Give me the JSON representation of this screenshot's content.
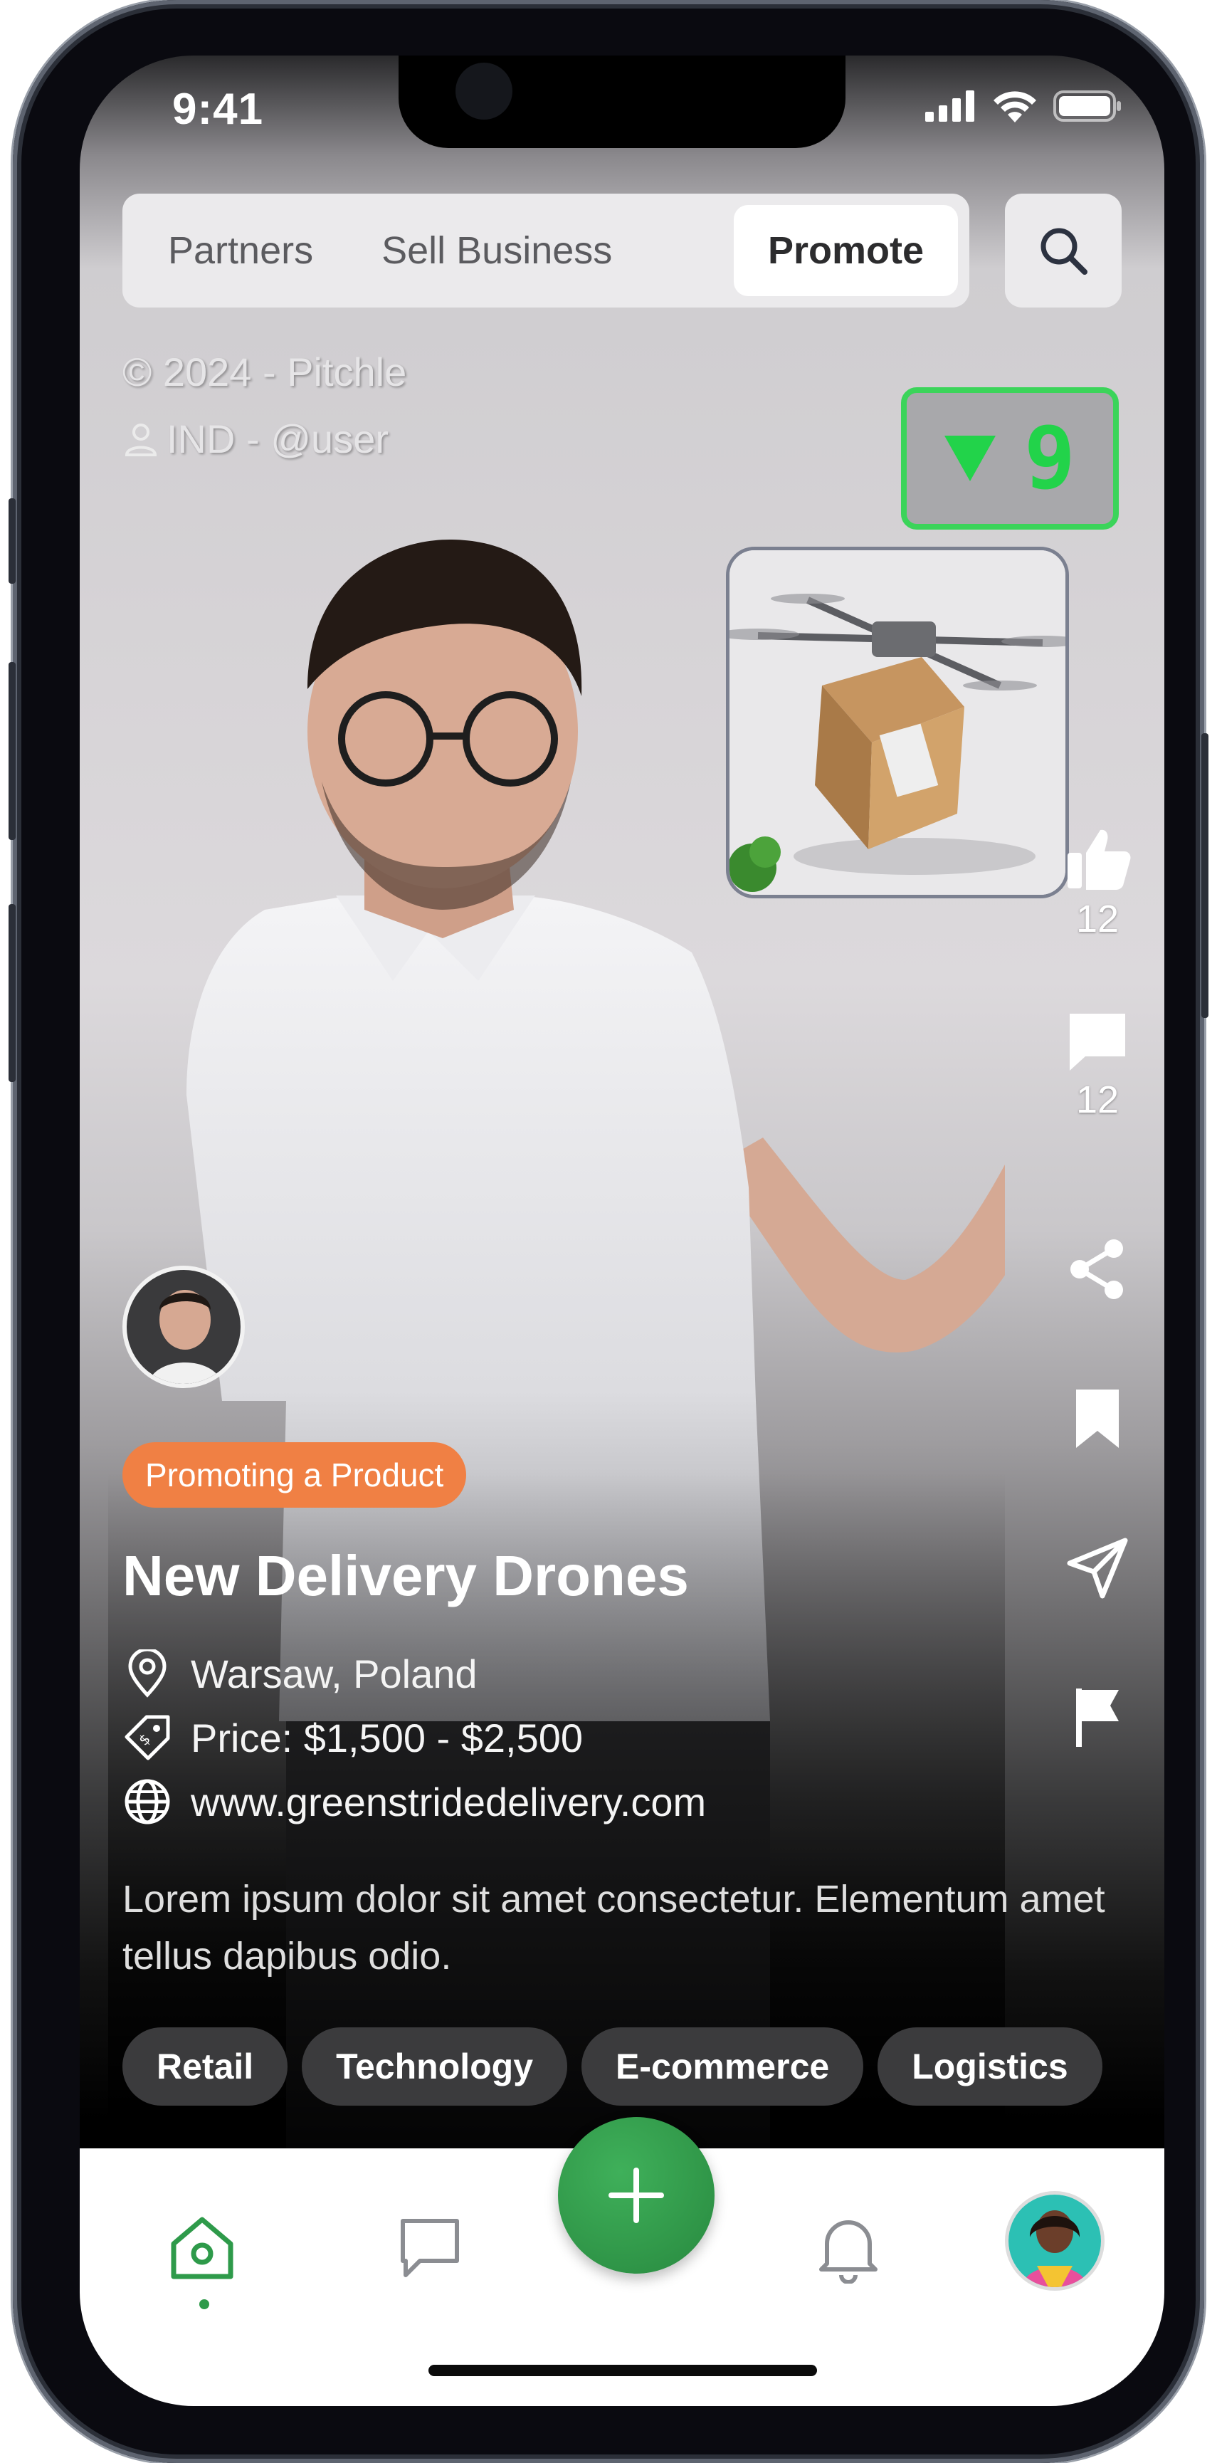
{
  "status_bar": {
    "time": "9:41"
  },
  "tabs": [
    {
      "label": "Partners",
      "active": false
    },
    {
      "label": "Sell Business",
      "active": false
    },
    {
      "label": "Promote",
      "active": true
    }
  ],
  "watermark": {
    "copyright": "© 2024 - Pitchle",
    "user": "IND - @user"
  },
  "counter": {
    "value": "9",
    "direction": "down",
    "color": "#22d34a"
  },
  "actions": {
    "likes": "12",
    "comments": "12"
  },
  "post": {
    "badge": "Promoting a Product",
    "badge_color": "#f08044",
    "title": "New Delivery Drones",
    "location": "Warsaw, Poland",
    "price": "Price: $1,500 - $2,500",
    "website": "www.greenstridedelivery.com",
    "description": "Lorem ipsum dolor sit amet consectetur. Elementum amet tellus dapibus odio.",
    "tags": [
      "Retail",
      "Technology",
      "E-commerce",
      "Logistics"
    ]
  },
  "nav": {
    "items": [
      "home-icon",
      "chat-icon",
      "add-icon",
      "bell-icon",
      "profile-avatar"
    ],
    "accent": "#2e9a4a"
  }
}
